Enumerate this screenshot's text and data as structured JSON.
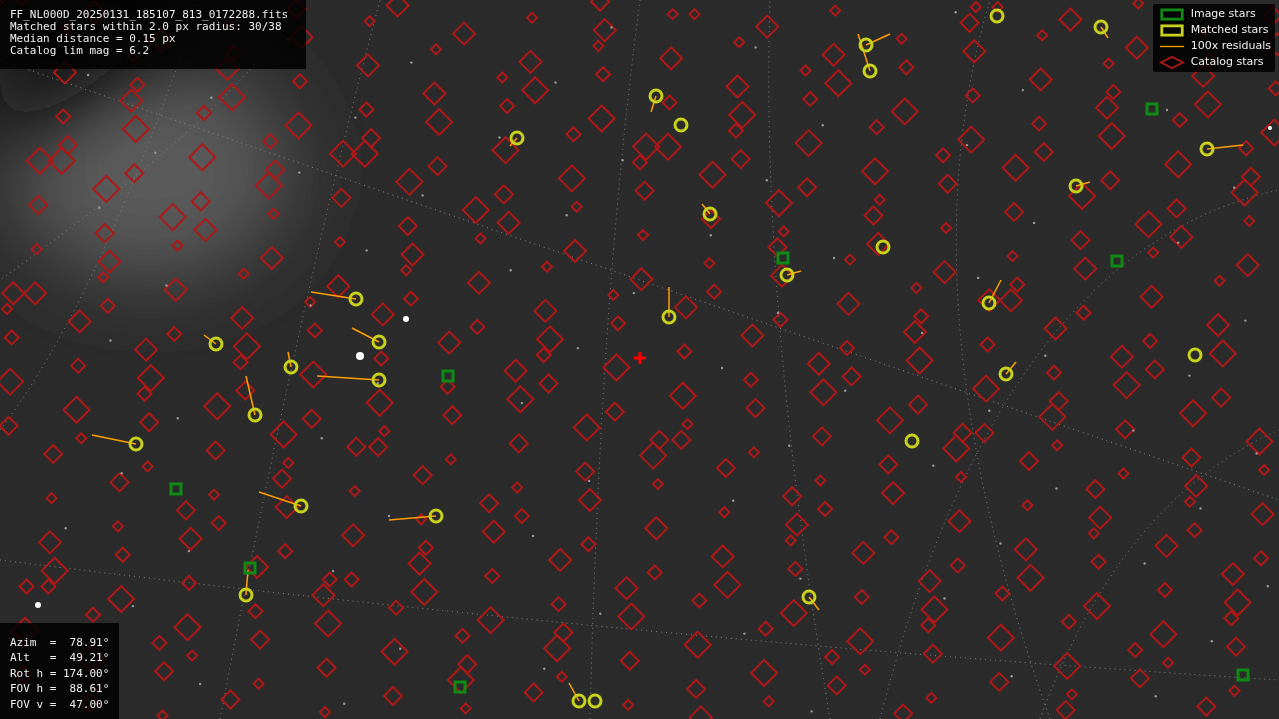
{
  "info": [
    "FF_NL000D_20250131_185107_813_0172288.fits",
    "Matched stars within 2.0 px radius: 30/38",
    "Median distance = 0.15 px",
    "Catalog lim mag = 6.2"
  ],
  "legend": [
    {
      "kind": "image",
      "label": "Image stars"
    },
    {
      "kind": "matched",
      "label": "Matched stars"
    },
    {
      "kind": "residual",
      "label": "100x residuals"
    },
    {
      "kind": "catalog",
      "label": "Catalog stars"
    }
  ],
  "pointing": [
    "Azim  =  78.91°",
    "Alt   =  49.21°",
    "Rot h = 174.00°",
    "FOV h =  88.61°",
    "FOV v =  47.00°"
  ]
}
